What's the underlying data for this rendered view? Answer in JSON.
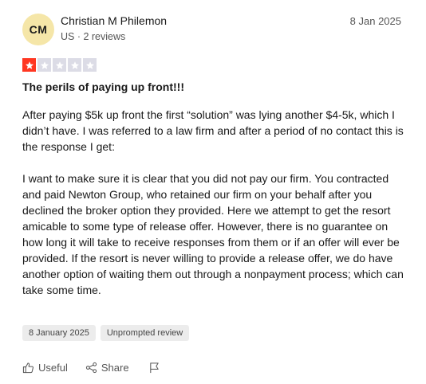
{
  "review": {
    "author": {
      "initials": "CM",
      "name": "Christian M Philemon",
      "meta": "US · 2 reviews"
    },
    "date": "8 Jan 2025",
    "rating": {
      "value": 1,
      "max": 5
    },
    "title": "The perils of paying up front!!!",
    "body": [
      "After paying $5k up front the first “solution” was lying another $4-5k, which I didn’t have. I was referred to a law firm and after a period of no contact this is the response I get:",
      "I want to make sure it is clear that you did not pay our firm. You contracted and paid Newton Group, who retained our firm on your behalf after you declined the broker option they provided. Here we attempt to get the resort amicable to some type of release offer. However, there is no guarantee on how long it will take to receive responses from them or if an offer will ever be provided. If the resort is never willing to provide a release offer, we do have another option of waiting them out through a nonpayment process; which can take some time."
    ],
    "tags": {
      "experience_date": "8 January 2025",
      "type": "Unprompted review"
    },
    "actions": {
      "useful": "Useful",
      "share": "Share"
    }
  },
  "colors": {
    "star_filled": "#ff3722",
    "star_empty": "#dcdce6",
    "avatar_bg": "#f5e6a8"
  }
}
